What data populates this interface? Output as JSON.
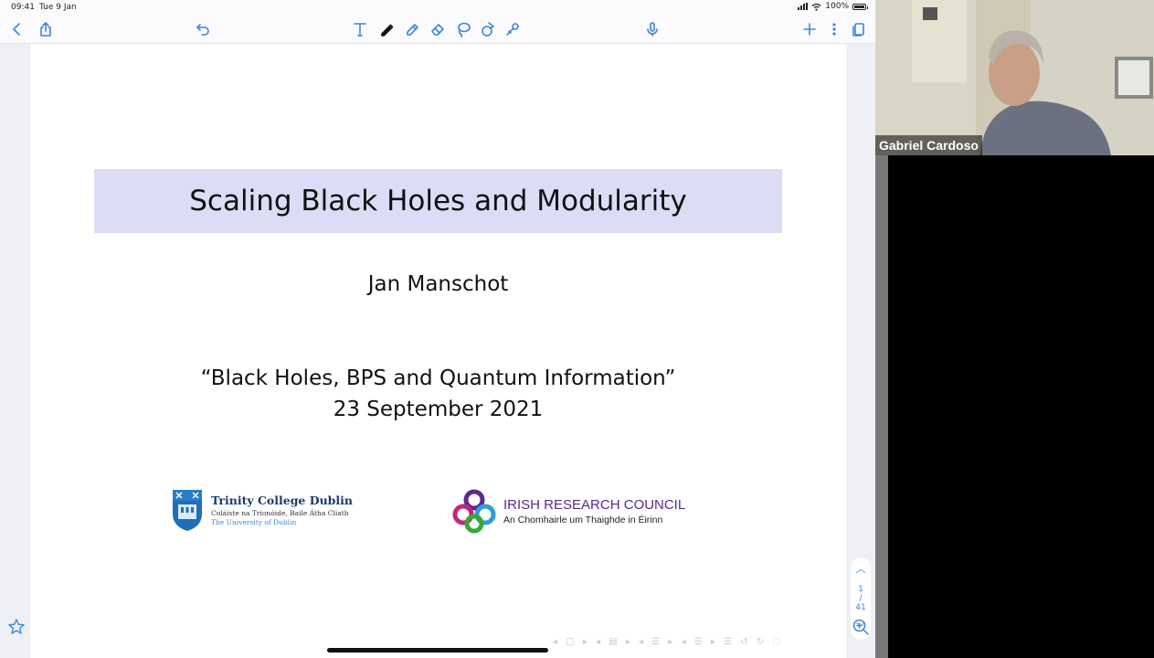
{
  "status": {
    "time": "09:41",
    "date": "Tue 9 Jan",
    "battery": "100%"
  },
  "toolbar": {
    "icons": [
      "back-icon",
      "share-icon",
      "undo-icon",
      "text-tool-icon",
      "pen-icon",
      "highlighter-icon",
      "eraser-icon",
      "lasso-icon",
      "shapes-icon",
      "laser-pointer-icon",
      "microphone-icon",
      "add-icon",
      "more-icon",
      "pages-icon"
    ]
  },
  "slide": {
    "title": "Scaling Black Holes and Modularity",
    "author": "Jan Manschot",
    "conference": "“Black Holes, BPS and Quantum Information”",
    "date": "23 September 2021",
    "tcd": {
      "name": "Trinity College Dublin",
      "irish": "Coláiste na Tríonóide, Baile Átha Cliath",
      "sub": "The University of Dublin"
    },
    "irc": {
      "name": "IRISH RESEARCH COUNCIL",
      "irish": "An Chomhairle um Thaighde in Éirinn"
    }
  },
  "pager": {
    "current": "1",
    "total": "41"
  },
  "video": {
    "participant": "Gabriel Cardoso"
  },
  "colors": {
    "accent": "#3a86e0",
    "title_bg": "#dcdcf6",
    "irc_purple": "#5b2a8c",
    "tcd_blue": "#1b3a6b"
  }
}
